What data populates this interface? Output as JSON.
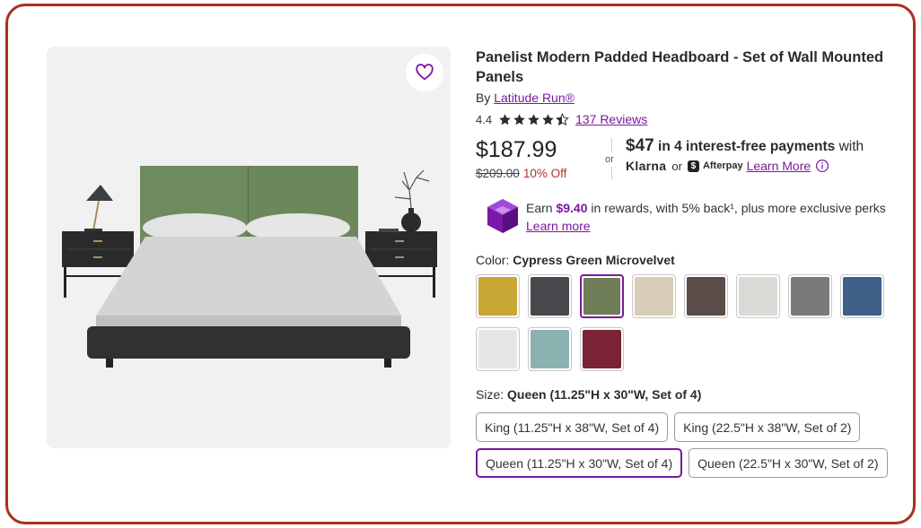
{
  "product": {
    "title_line1": "Panelist Modern Padded Headboard - Set of Wall Mounted",
    "title_line2": "Panels",
    "by_prefix": "By ",
    "brand": "Latitude Run®",
    "rating": "4.4",
    "rating_value": 4.4,
    "reviews": "137 Reviews"
  },
  "favorite": {
    "icon": "heart-icon"
  },
  "pricing": {
    "price": "$187.99",
    "was": "$209.00",
    "off": "10% Off",
    "or": "or",
    "klarna_amount": "$47",
    "klarna_text": " in 4 interest-free payments",
    "klarna_with": " with",
    "klarna_brand": "Klarna",
    "or2": "or",
    "afterpay_badge": "$",
    "afterpay": "Afterpay",
    "learn_more": "Learn More"
  },
  "rewards": {
    "earn": "Earn ",
    "amount": "$9.40",
    "rest": " in rewards, with 5% back¹, plus more exclusive perks",
    "learn_more": "Learn more"
  },
  "color": {
    "label": "Color: ",
    "selected": "Cypress Green Microvelvet",
    "swatches": [
      {
        "name": "swatch-mustard",
        "color": "#c9a735"
      },
      {
        "name": "swatch-charcoal",
        "color": "#48484d"
      },
      {
        "name": "swatch-cypress-green",
        "color": "#6f7d58",
        "selected": true
      },
      {
        "name": "swatch-beige",
        "color": "#d8cdb8"
      },
      {
        "name": "swatch-brown",
        "color": "#5a4c48"
      },
      {
        "name": "swatch-light-gray",
        "color": "#d9d9d6"
      },
      {
        "name": "swatch-gray",
        "color": "#7c7a78"
      },
      {
        "name": "swatch-navy",
        "color": "#3f5f88"
      },
      {
        "name": "swatch-partial",
        "color": "#e6e6e6"
      },
      {
        "name": "swatch-aqua",
        "color": "#8bb1b1"
      },
      {
        "name": "swatch-burgundy",
        "color": "#7a2335"
      }
    ]
  },
  "size": {
    "label": "Size: ",
    "selected": "Queen (11.25\"H x 30\"W, Set of 4)",
    "options": [
      "King (11.25\"H x 38\"W, Set of 4)",
      "King (22.5\"H x 38\"W, Set of 2)",
      "Queen (11.25\"H x 30\"W, Set of 4)",
      "Queen (22.5\"H x 30\"W, Set of 2)"
    ],
    "selected_index": 2
  },
  "colors": {
    "accent": "#7b189f",
    "frame": "#a8321c",
    "discount": "#b5302a"
  }
}
